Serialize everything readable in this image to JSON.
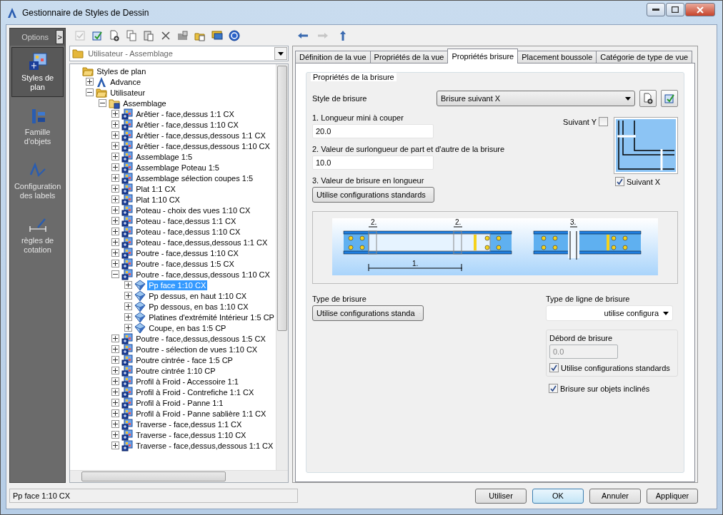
{
  "window": {
    "title": "Gestionnaire de Styles de Dessin"
  },
  "sidebar": {
    "header": "Options",
    "expand_button": ">",
    "items": [
      {
        "label": "Styles de plan",
        "kind": "plan",
        "selected": true
      },
      {
        "label": "Famille d'objets",
        "kind": "family",
        "selected": false
      },
      {
        "label": "Configuration des labels",
        "kind": "labels",
        "selected": false
      },
      {
        "label": "règles de cotation",
        "kind": "dimension",
        "selected": false
      }
    ]
  },
  "toolbar": [
    {
      "kind": "check",
      "disabled": true
    },
    {
      "kind": "edit",
      "disabled": false
    },
    {
      "kind": "new",
      "disabled": false
    },
    {
      "kind": "copy",
      "disabled": false
    },
    {
      "kind": "paste",
      "disabled": false
    },
    {
      "kind": "delete",
      "disabled": false
    },
    {
      "kind": "import",
      "disabled": false
    },
    {
      "kind": "export",
      "disabled": false
    },
    {
      "kind": "screen",
      "disabled": false
    },
    {
      "kind": "help",
      "disabled": false
    }
  ],
  "folder_combo": {
    "value": "Utilisateur - Assemblage"
  },
  "tree": {
    "label": "Styles de plan",
    "kind": "folder",
    "selected": false,
    "children": [
      {
        "label": "Advance",
        "kind": "logo",
        "expanded": false,
        "selected": false
      },
      {
        "label": "Utilisateur",
        "kind": "folder",
        "expanded": true,
        "selected": false,
        "children": [
          {
            "label": "Assemblage",
            "kind": "style-folder",
            "expanded": true,
            "selected": false,
            "children": [
              {
                "label": "Arêtier - face,dessus 1:1 CX",
                "kind": "style",
                "expanded": false,
                "selected": false
              },
              {
                "label": "Arêtier - face,dessus 1:10 CX",
                "kind": "style",
                "expanded": false,
                "selected": false
              },
              {
                "label": "Arêtier - face,dessus,dessous 1:1 CX",
                "kind": "style",
                "expanded": false,
                "selected": false
              },
              {
                "label": "Arêtier - face,dessus,dessous 1:10 CX",
                "kind": "style",
                "expanded": false,
                "selected": false
              },
              {
                "label": "Assemblage 1:5",
                "kind": "style",
                "expanded": false,
                "selected": false
              },
              {
                "label": "Assemblage Poteau 1:5",
                "kind": "style",
                "expanded": false,
                "selected": false
              },
              {
                "label": "Assemblage sélection coupes 1:5",
                "kind": "style",
                "expanded": false,
                "selected": false
              },
              {
                "label": "Plat 1:1 CX",
                "kind": "style",
                "expanded": false,
                "selected": false
              },
              {
                "label": "Plat 1:10 CX",
                "kind": "style",
                "expanded": false,
                "selected": false
              },
              {
                "label": "Poteau - choix des vues 1:10 CX",
                "kind": "style",
                "expanded": false,
                "selected": false
              },
              {
                "label": "Poteau - face,dessus 1:1 CX",
                "kind": "style",
                "expanded": false,
                "selected": false
              },
              {
                "label": "Poteau - face,dessus 1:10 CX",
                "kind": "style",
                "expanded": false,
                "selected": false
              },
              {
                "label": "Poteau - face,dessus,dessous 1:1 CX",
                "kind": "style",
                "expanded": false,
                "selected": false
              },
              {
                "label": "Poutre - face,dessus 1:10 CX",
                "kind": "style",
                "expanded": false,
                "selected": false
              },
              {
                "label": "Poutre - face,dessus 1:5 CX",
                "kind": "style",
                "expanded": false,
                "selected": false
              },
              {
                "label": "Poutre - face,dessus,dessous 1:10 CX",
                "kind": "style",
                "expanded": true,
                "selected": false,
                "children": [
                  {
                    "label": "Pp face 1:10 CX",
                    "kind": "view",
                    "expanded": false,
                    "selected": true
                  },
                  {
                    "label": "Pp dessus, en haut 1:10 CX",
                    "kind": "view",
                    "expanded": false,
                    "selected": false
                  },
                  {
                    "label": "Pp dessous, en bas 1:10 CX",
                    "kind": "view",
                    "expanded": false,
                    "selected": false
                  },
                  {
                    "label": "Platines d'extrémité Intérieur 1:5 CP",
                    "kind": "view",
                    "expanded": false,
                    "selected": false
                  },
                  {
                    "label": "Coupe, en bas 1:5 CP",
                    "kind": "view",
                    "expanded": false,
                    "selected": false
                  }
                ]
              },
              {
                "label": "Poutre - face,dessus,dessous 1:5 CX",
                "kind": "style",
                "expanded": false,
                "selected": false
              },
              {
                "label": "Poutre - sélection de vues 1:10 CX",
                "kind": "style",
                "expanded": false,
                "selected": false
              },
              {
                "label": "Poutre cintrée - face 1:5 CP",
                "kind": "style",
                "expanded": false,
                "selected": false
              },
              {
                "label": "Poutre cintrée 1:10 CP",
                "kind": "style",
                "expanded": false,
                "selected": false
              },
              {
                "label": "Profil à Froid - Accessoire 1:1",
                "kind": "style",
                "expanded": false,
                "selected": false
              },
              {
                "label": "Profil à Froid - Contrefiche 1:1 CX",
                "kind": "style",
                "expanded": false,
                "selected": false
              },
              {
                "label": "Profil à Froid - Panne 1:1",
                "kind": "style",
                "expanded": false,
                "selected": false
              },
              {
                "label": "Profil à Froid - Panne sablière 1:1 CX",
                "kind": "style",
                "expanded": false,
                "selected": false
              },
              {
                "label": "Traverse - face,dessus 1:1 CX",
                "kind": "style",
                "expanded": false,
                "selected": false
              },
              {
                "label": "Traverse - face,dessus 1:10 CX",
                "kind": "style",
                "expanded": false,
                "selected": false
              },
              {
                "label": "Traverse - face,dessus,dessous 1:1 CX",
                "kind": "style",
                "expanded": false,
                "selected": false
              }
            ]
          }
        ]
      }
    ]
  },
  "status_field": {
    "value": "Pp face 1:10 CX"
  },
  "nav": [
    {
      "kind": "back",
      "disabled": false
    },
    {
      "kind": "forward",
      "disabled": true
    },
    {
      "kind": "up",
      "disabled": false
    }
  ],
  "tabs": [
    {
      "label": "Définition de la vue",
      "selected": false
    },
    {
      "label": "Propriétés de la vue",
      "selected": false
    },
    {
      "label": "Propriétés brisure",
      "selected": true
    },
    {
      "label": "Placement boussole",
      "selected": false
    },
    {
      "label": "Catégorie de type de vue",
      "selected": false
    }
  ],
  "break_properties": {
    "group_title": "Propriétés de la brisure",
    "style_label": "Style de brisure",
    "style_value": "Brisure suivant X",
    "min_length_label": "1. Longueur mini à couper",
    "min_length_value": "20.0",
    "overlength_label": "2. Valeur de surlongueur de part et d'autre de la brisure",
    "overlength_value": "10.0",
    "break_length_label": "3. Valeur de brisure en longueur",
    "break_length_value": "Utilise configurations standards",
    "along_y": {
      "label": "Suivant Y",
      "checked": false
    },
    "along_x": {
      "label": "Suivant X",
      "checked": true
    },
    "diagram_labels": [
      "2.",
      "2.",
      "1.",
      "3."
    ],
    "break_type_label": "Type de brisure",
    "break_type_value": "Utilise configurations standa",
    "line_type_label": "Type de ligne de brisure",
    "line_type_value": "utilise configura",
    "overhang_label": "Débord de brisure",
    "overhang_value": "0.0",
    "overhang_disabled": true,
    "use_standard": {
      "label": "Utilise configurations standards",
      "checked": true
    },
    "inclined": {
      "label": "Brisure sur objets inclinés",
      "checked": true
    }
  },
  "buttons": [
    {
      "label": "Utiliser",
      "default": false
    },
    {
      "label": "OK",
      "default": true
    },
    {
      "label": "Annuler",
      "default": false
    },
    {
      "label": "Appliquer",
      "default": false
    }
  ]
}
